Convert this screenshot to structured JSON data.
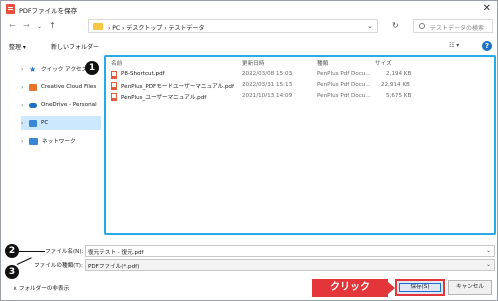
{
  "window": {
    "title": "PDFファイルを保存",
    "close_glyph": "✕"
  },
  "nav": {
    "back": "←",
    "forward": "→",
    "up": "↑",
    "path": "›  PC  ›  デスクトップ  ›  テストデータ",
    "refresh": "↻",
    "search_placeholder": "テストデータの検索"
  },
  "toolbar": {
    "organize": "整理 ▾",
    "new_folder": "新しいフォルダー",
    "view": "☷ ▾",
    "help": "?"
  },
  "sidebar": {
    "items": [
      {
        "label": "クイック アクセス",
        "icon": "star-icon",
        "color": "#1d6fc8"
      },
      {
        "label": "Creative Cloud Files",
        "icon": "cloud-icon",
        "color": "#e8742a"
      },
      {
        "label": "OneDrive - Personal",
        "icon": "onedrive-icon",
        "color": "#1d6fc8"
      },
      {
        "label": "PC",
        "icon": "pc-icon",
        "color": "#3a86d6",
        "selected": true
      },
      {
        "label": "ネットワーク",
        "icon": "network-icon",
        "color": "#3a86d6"
      }
    ]
  },
  "filelist": {
    "columns": [
      "名前",
      "更新日時",
      "種類",
      "サイズ"
    ],
    "rows": [
      {
        "name": "P8-Shortcut.pdf",
        "date": "2022/03/08 15:03",
        "type": "PenPlus Pdf Docu...",
        "size": "2,194 KB"
      },
      {
        "name": "PenPlus_PDFモードユーザーマニュアル.pdf",
        "date": "2022/03/31 15:13",
        "type": "PenPlus Pdf Docu...",
        "size": "22,914 KB"
      },
      {
        "name": "PenPlus_ユーザーマニュアル.pdf",
        "date": "2021/10/13 14:09",
        "type": "PenPlus Pdf Docu...",
        "size": "5,675 KB"
      }
    ]
  },
  "form": {
    "filename_label": "ファイル名(N):",
    "filename_value": "復元テスト - 復元.pdf",
    "filetype_label": "ファイルの種類(T):",
    "filetype_value": "PDFファイル(*.pdf)"
  },
  "footer": {
    "hide_folders": "∧  フォルダーの非表示",
    "click_callout": "クリック",
    "save": "保存(S)",
    "cancel": "キャンセル"
  },
  "badges": [
    "1",
    "2",
    "3"
  ],
  "colors": {
    "accent_blue": "#29a9e8",
    "callout_red": "#e3353a",
    "selected_bg": "#cce8ff"
  }
}
